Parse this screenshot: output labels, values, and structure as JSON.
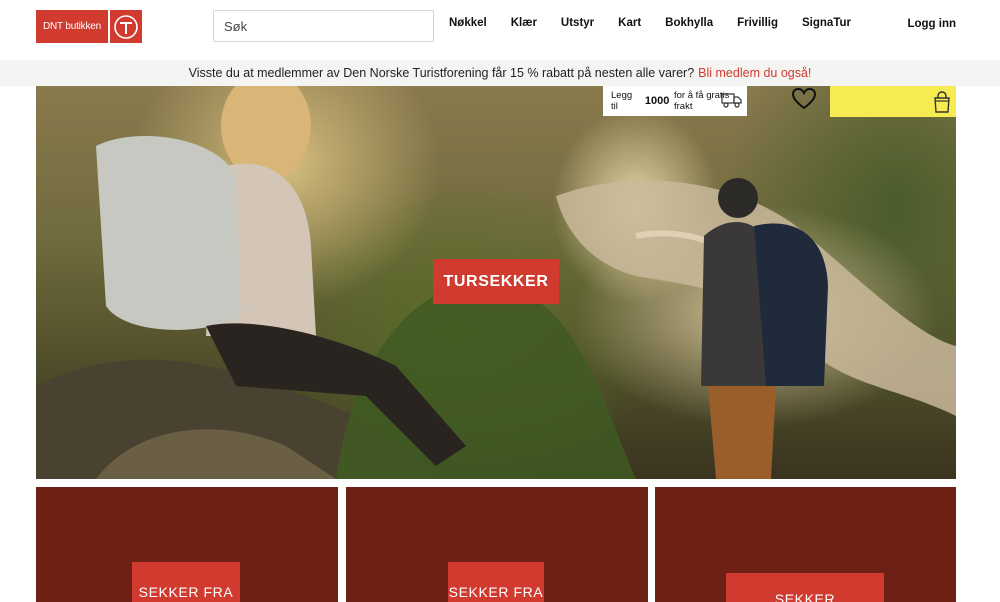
{
  "header": {
    "logo_text": "DNT butikken",
    "search_placeholder": "Søk",
    "nav": [
      {
        "label": "Nøkkel"
      },
      {
        "label": "Klær"
      },
      {
        "label": "Utstyr"
      },
      {
        "label": "Kart"
      },
      {
        "label": "Bokhylla"
      },
      {
        "label": "Frivillig"
      },
      {
        "label": "SignaTur"
      }
    ],
    "login": "Logg inn"
  },
  "banner": {
    "text": "Visste du at medlemmer av Den Norske Turistforening får 15 % rabatt på nesten alle varer?",
    "link": "Bli medlem du også!"
  },
  "shipping": {
    "prefix": "Legg til",
    "amount": "1000",
    "suffix": "for å få gratis frakt"
  },
  "hero": {
    "cta": "TURSEKKER"
  },
  "cards": [
    {
      "label": "SEKKER FRA"
    },
    {
      "label": "SEKKER FRA"
    },
    {
      "label": "SEKKER"
    }
  ],
  "icons": {
    "logo_badge": "dnt-badge-icon",
    "heart": "heart-icon",
    "cart": "shopping-bag-icon",
    "truck": "truck-icon"
  },
  "colors": {
    "brand_red": "#d03a2f",
    "card_brown": "#6e2015",
    "cart_yellow": "#f6ec52",
    "banner_bg": "#f4f4f2"
  }
}
